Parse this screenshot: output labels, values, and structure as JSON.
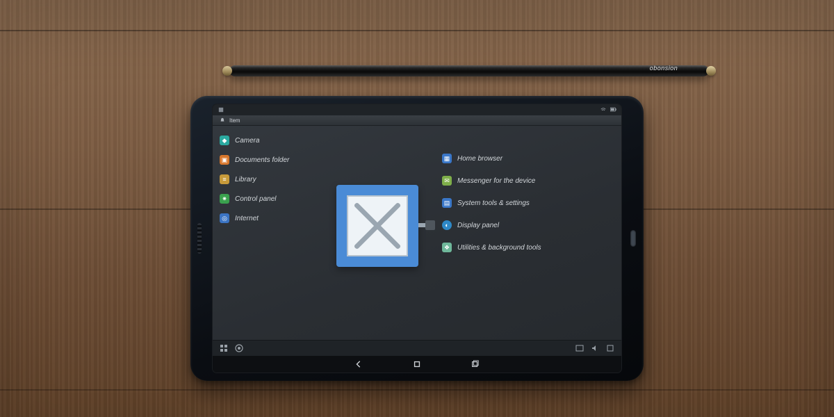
{
  "stylus": {
    "brand": "obonsion"
  },
  "statusbar": {
    "left_label": ""
  },
  "titlebar": {
    "text": "Item"
  },
  "sidebar": {
    "items": [
      {
        "icon": "diamond-icon",
        "color": "teal",
        "label": "Camera"
      },
      {
        "icon": "folder-icon",
        "color": "orange",
        "label": "Documents folder"
      },
      {
        "icon": "tag-icon",
        "color": "gold",
        "label": "Library"
      },
      {
        "icon": "gear-icon",
        "color": "green",
        "label": "Control panel"
      },
      {
        "icon": "app-icon",
        "color": "blue",
        "label": "Internet"
      }
    ]
  },
  "center_tile": {
    "name": "close"
  },
  "infolist": {
    "items": [
      {
        "icon": "window-icon",
        "color": "bluebox",
        "label": "Home browser"
      },
      {
        "icon": "chat-icon",
        "color": "lime",
        "label": "Messenger for the device"
      },
      {
        "icon": "calendar-icon",
        "color": "bluebox",
        "label": "System tools & settings"
      },
      {
        "icon": "globe-icon",
        "color": "cyan",
        "label": "Display panel"
      },
      {
        "icon": "shield-icon",
        "color": "mint",
        "label": "Utilities & background tools"
      }
    ]
  },
  "taskbar": {
    "items": []
  }
}
